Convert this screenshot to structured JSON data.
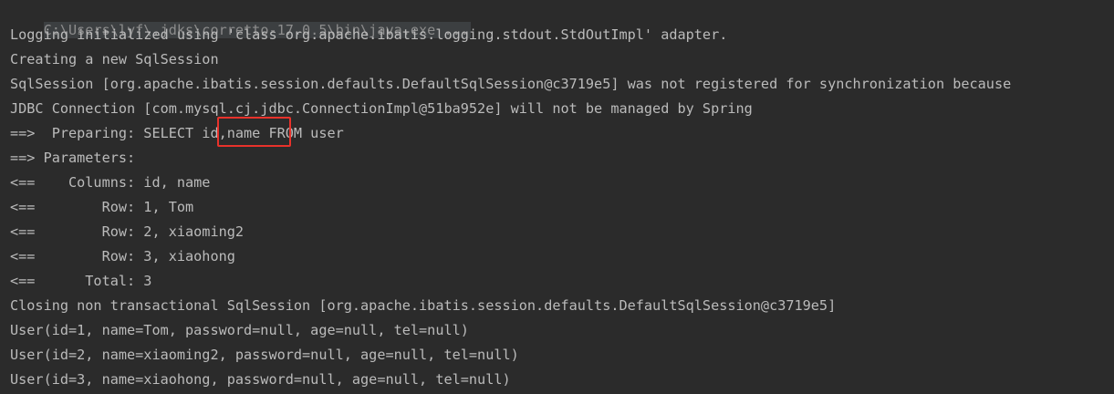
{
  "console": {
    "command": "C:\\Users\\lyf\\.jdks\\corretto-17.0.5\\bin\\java.exe ...",
    "lines": [
      "Logging initialized using 'class org.apache.ibatis.logging.stdout.StdOutImpl' adapter.",
      "Creating a new SqlSession",
      "SqlSession [org.apache.ibatis.session.defaults.DefaultSqlSession@c3719e5] was not registered for synchronization because",
      "JDBC Connection [com.mysql.cj.jdbc.ConnectionImpl@51ba952e] will not be managed by Spring",
      "==>  Preparing: SELECT id,name FROM user",
      "==> Parameters: ",
      "<==    Columns: id, name",
      "<==        Row: 1, Tom",
      "<==        Row: 2, xiaoming2",
      "<==        Row: 3, xiaohong",
      "<==      Total: 3",
      "Closing non transactional SqlSession [org.apache.ibatis.session.defaults.DefaultSqlSession@c3719e5]",
      "User(id=1, name=Tom, password=null, age=null, tel=null)",
      "User(id=2, name=xiaoming2, password=null, age=null, tel=null)",
      "User(id=3, name=xiaohong, password=null, age=null, tel=null)"
    ],
    "highlighted_text": "id,name"
  },
  "colors": {
    "background": "#2b2b2b",
    "text": "#bbbbbb",
    "command_text": "#8c8c8c",
    "highlight_border": "#e8322b"
  }
}
